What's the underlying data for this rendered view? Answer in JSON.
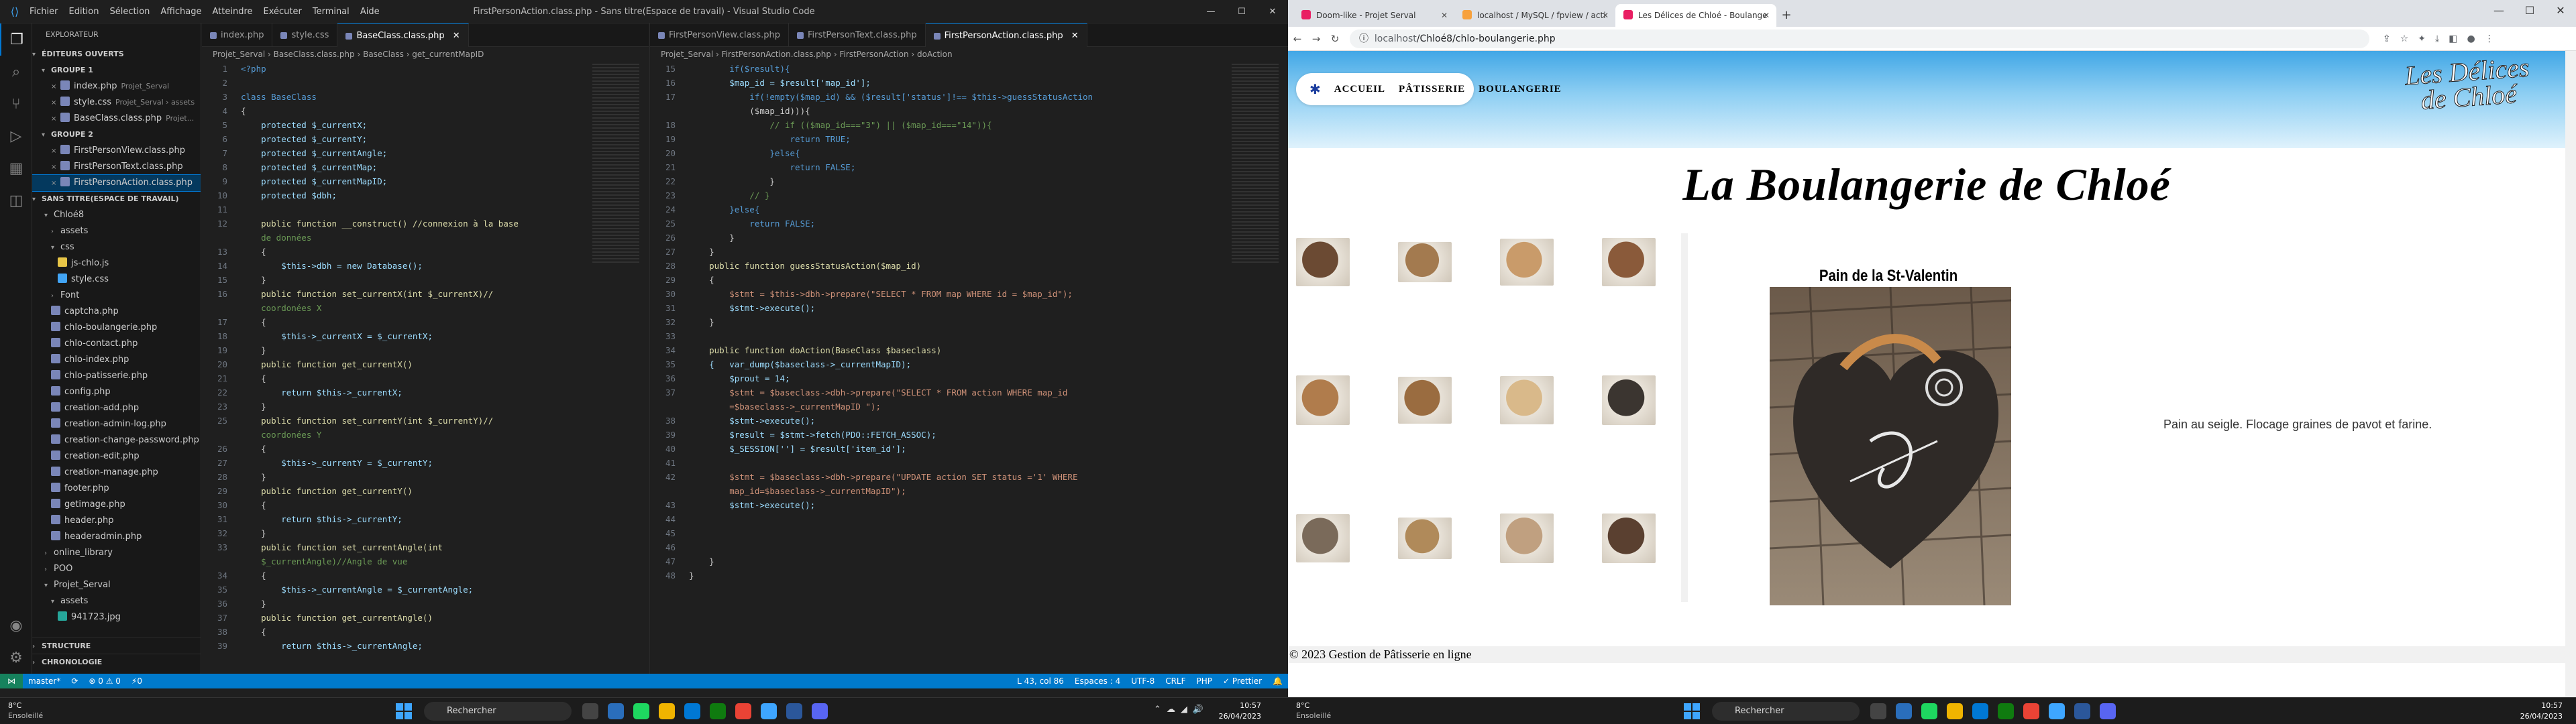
{
  "vscode": {
    "menu": [
      "Fichier",
      "Edition",
      "Sélection",
      "Affichage",
      "Atteindre",
      "Exécuter",
      "Terminal",
      "Aide"
    ],
    "window_title": "FirstPersonAction.class.php - Sans titre(Espace de travail) - Visual Studio Code",
    "sidebar": {
      "header": "EXPLORATEUR",
      "open_editors": "ÉDITEURS OUVERTS",
      "group1": "GROUPE 1",
      "group1_files": [
        {
          "name": "index.php",
          "hint": "Projet_Serval"
        },
        {
          "name": "style.css",
          "hint": "Projet_Serval › assets"
        },
        {
          "name": "BaseClass.class.php",
          "hint": "Projet..."
        }
      ],
      "group2": "GROUPE 2",
      "group2_files": [
        {
          "name": "FirstPersonView.class.php"
        },
        {
          "name": "FirstPersonText.class.php"
        },
        {
          "name": "FirstPersonAction.class.php"
        }
      ],
      "workspace": "SANS TITRE(ESPACE DE TRAVAIL)",
      "tree": [
        {
          "name": "Chloé8",
          "type": "folder",
          "open": true
        },
        {
          "name": "assets",
          "type": "folder"
        },
        {
          "name": "css",
          "type": "folder",
          "open": true
        },
        {
          "name": "js-chlo.js",
          "type": "js"
        },
        {
          "name": "style.css",
          "type": "css"
        },
        {
          "name": "Font",
          "type": "folder"
        },
        {
          "name": "captcha.php",
          "type": "php"
        },
        {
          "name": "chlo-boulangerie.php",
          "type": "php"
        },
        {
          "name": "chlo-contact.php",
          "type": "php"
        },
        {
          "name": "chlo-index.php",
          "type": "php"
        },
        {
          "name": "chlo-patisserie.php",
          "type": "php"
        },
        {
          "name": "config.php",
          "type": "php"
        },
        {
          "name": "creation-add.php",
          "type": "php"
        },
        {
          "name": "creation-admin-log.php",
          "type": "php"
        },
        {
          "name": "creation-change-password.php",
          "type": "php"
        },
        {
          "name": "creation-edit.php",
          "type": "php"
        },
        {
          "name": "creation-manage.php",
          "type": "php"
        },
        {
          "name": "footer.php",
          "type": "php"
        },
        {
          "name": "getimage.php",
          "type": "php"
        },
        {
          "name": "header.php",
          "type": "php"
        },
        {
          "name": "headeradmin.php",
          "type": "php"
        },
        {
          "name": "online_library",
          "type": "folder"
        },
        {
          "name": "POO",
          "type": "folder"
        },
        {
          "name": "Projet_Serval",
          "type": "folder",
          "open": true
        },
        {
          "name": "assets",
          "type": "folder",
          "open": true
        },
        {
          "name": "941723.jpg",
          "type": "jpg"
        }
      ],
      "outline": "STRUCTURE",
      "timeline": "CHRONOLOGIE"
    },
    "pane1": {
      "tabs": [
        "index.php",
        "style.css",
        "BaseClass.class.php"
      ],
      "breadcrumb": "Projet_Serval › BaseClass.class.php › BaseClass › get_currentMapID",
      "lines": [
        {
          "n": "1",
          "t": "<?php",
          "c": "kw"
        },
        {
          "n": "2",
          "t": "",
          "c": ""
        },
        {
          "n": "3",
          "t": "class BaseClass",
          "c": "kw"
        },
        {
          "n": "4",
          "t": "{",
          "c": ""
        },
        {
          "n": "5",
          "t": "    protected $_currentX;",
          "c": "var"
        },
        {
          "n": "6",
          "t": "    protected $_currentY;",
          "c": "var"
        },
        {
          "n": "7",
          "t": "    protected $_currentAngle;",
          "c": "var"
        },
        {
          "n": "8",
          "t": "    protected $_currentMap;",
          "c": "var"
        },
        {
          "n": "9",
          "t": "    protected $_currentMapID;",
          "c": "var"
        },
        {
          "n": "10",
          "t": "    protected $dbh;",
          "c": "var"
        },
        {
          "n": "11",
          "t": "",
          "c": ""
        },
        {
          "n": "12",
          "t": "    public function __construct() //connexion à la base",
          "c": "fn"
        },
        {
          "n": "",
          "t": "    de données",
          "c": "cm"
        },
        {
          "n": "13",
          "t": "    {",
          "c": ""
        },
        {
          "n": "14",
          "t": "        $this->dbh = new Database();",
          "c": "var"
        },
        {
          "n": "15",
          "t": "    }",
          "c": ""
        },
        {
          "n": "16",
          "t": "    public function set_currentX(int $_currentX)//",
          "c": "fn"
        },
        {
          "n": "",
          "t": "    coordonées X",
          "c": "cm"
        },
        {
          "n": "17",
          "t": "    {",
          "c": ""
        },
        {
          "n": "18",
          "t": "        $this->_currentX = $_currentX;",
          "c": "var"
        },
        {
          "n": "19",
          "t": "    }",
          "c": ""
        },
        {
          "n": "20",
          "t": "    public function get_currentX()",
          "c": "fn"
        },
        {
          "n": "21",
          "t": "    {",
          "c": ""
        },
        {
          "n": "22",
          "t": "        return $this->_currentX;",
          "c": "var"
        },
        {
          "n": "23",
          "t": "    }",
          "c": ""
        },
        {
          "n": "25",
          "t": "    public function set_currentY(int $_currentY)//",
          "c": "fn"
        },
        {
          "n": "",
          "t": "    coordonées Y",
          "c": "cm"
        },
        {
          "n": "26",
          "t": "    {",
          "c": ""
        },
        {
          "n": "27",
          "t": "        $this->_currentY = $_currentY;",
          "c": "var"
        },
        {
          "n": "28",
          "t": "    }",
          "c": ""
        },
        {
          "n": "29",
          "t": "    public function get_currentY()",
          "c": "fn"
        },
        {
          "n": "30",
          "t": "    {",
          "c": ""
        },
        {
          "n": "31",
          "t": "        return $this->_currentY;",
          "c": "var"
        },
        {
          "n": "32",
          "t": "    }",
          "c": ""
        },
        {
          "n": "33",
          "t": "    public function set_currentAngle(int",
          "c": "fn"
        },
        {
          "n": "",
          "t": "    $_currentAngle)//Angle de vue",
          "c": "cm"
        },
        {
          "n": "34",
          "t": "    {",
          "c": ""
        },
        {
          "n": "35",
          "t": "        $this->_currentAngle = $_currentAngle;",
          "c": "var"
        },
        {
          "n": "36",
          "t": "    }",
          "c": ""
        },
        {
          "n": "37",
          "t": "    public function get_currentAngle()",
          "c": "fn"
        },
        {
          "n": "38",
          "t": "    {",
          "c": ""
        },
        {
          "n": "39",
          "t": "        return $this->_currentAngle;",
          "c": "var"
        }
      ]
    },
    "pane2": {
      "tabs": [
        "FirstPersonView.class.php",
        "FirstPersonText.class.php",
        "FirstPersonAction.class.php"
      ],
      "breadcrumb": "Projet_Serval › FirstPersonAction.class.php › FirstPersonAction › doAction",
      "lines": [
        {
          "n": "15",
          "t": "        if($result){",
          "c": "kw"
        },
        {
          "n": "16",
          "t": "        $map_id = $result['map_id'];",
          "c": "var"
        },
        {
          "n": "17",
          "t": "            if(!empty($map_id) && ($result['status']!== $this->guessStatusAction",
          "c": "kw"
        },
        {
          "n": "",
          "t": "            ($map_id))){",
          "c": ""
        },
        {
          "n": "18",
          "t": "                // if (($map_id===\"3\") || ($map_id===\"14\")){",
          "c": "cm"
        },
        {
          "n": "19",
          "t": "                    return TRUE;",
          "c": "kw"
        },
        {
          "n": "20",
          "t": "                }else{",
          "c": "kw"
        },
        {
          "n": "21",
          "t": "                    return FALSE;",
          "c": "kw"
        },
        {
          "n": "22",
          "t": "                }",
          "c": ""
        },
        {
          "n": "23",
          "t": "            // }",
          "c": "cm"
        },
        {
          "n": "24",
          "t": "        }else{",
          "c": "kw"
        },
        {
          "n": "25",
          "t": "            return FALSE;",
          "c": "kw"
        },
        {
          "n": "26",
          "t": "        }",
          "c": ""
        },
        {
          "n": "27",
          "t": "    }",
          "c": ""
        },
        {
          "n": "28",
          "t": "    public function guessStatusAction($map_id)",
          "c": "fn"
        },
        {
          "n": "29",
          "t": "    {",
          "c": ""
        },
        {
          "n": "30",
          "t": "        $stmt = $this->dbh->prepare(\"SELECT * FROM map WHERE id = $map_id\");",
          "c": "str"
        },
        {
          "n": "31",
          "t": "        $stmt->execute();",
          "c": "var"
        },
        {
          "n": "32",
          "t": "    }",
          "c": ""
        },
        {
          "n": "33",
          "t": "",
          "c": ""
        },
        {
          "n": "34",
          "t": "    public function doAction(BaseClass $baseclass)",
          "c": "fn"
        },
        {
          "n": "35",
          "t": "    {   var_dump($baseclass->_currentMapID);",
          "c": "var"
        },
        {
          "n": "36",
          "t": "        $prout = 14;",
          "c": "var"
        },
        {
          "n": "37",
          "t": "        $stmt = $baseclass->dbh->prepare(\"SELECT * FROM action WHERE map_id",
          "c": "str"
        },
        {
          "n": "",
          "t": "        =$baseclass->_currentMapID \");",
          "c": "str"
        },
        {
          "n": "38",
          "t": "        $stmt->execute();",
          "c": "var"
        },
        {
          "n": "39",
          "t": "        $result = $stmt->fetch(PDO::FETCH_ASSOC);",
          "c": "var"
        },
        {
          "n": "40",
          "t": "        $_SESSION[''] = $result['item_id'];",
          "c": "var"
        },
        {
          "n": "41",
          "t": "",
          "c": ""
        },
        {
          "n": "42",
          "t": "        $stmt = $baseclass->dbh->prepare(\"UPDATE action SET status ='1' WHERE",
          "c": "str"
        },
        {
          "n": "",
          "t": "        map_id=$baseclass->_currentMapID\");",
          "c": "str"
        },
        {
          "n": "43",
          "t": "        $stmt->execute();",
          "c": "var"
        },
        {
          "n": "44",
          "t": "",
          "c": ""
        },
        {
          "n": "45",
          "t": "",
          "c": ""
        },
        {
          "n": "46",
          "t": "",
          "c": ""
        },
        {
          "n": "47",
          "t": "    }",
          "c": ""
        },
        {
          "n": "48",
          "t": "}",
          "c": ""
        }
      ]
    },
    "status": {
      "branch": "master*",
      "sync": "⟳",
      "problems": "⊗ 0 ⚠ 0",
      "ports": "⚡0",
      "position": "L 43, col 86",
      "spaces": "Espaces : 4",
      "encoding": "UTF-8",
      "eol": "CRLF",
      "lang": "PHP",
      "prettier": "✓ Prettier"
    }
  },
  "browser": {
    "tabs": [
      {
        "title": "Doom-like - Projet Serval",
        "color": "#e91e63"
      },
      {
        "title": "localhost / MySQL / fpview / acti",
        "color": "#f7a13d"
      },
      {
        "title": "Les Délices de Chloé - Boulange",
        "color": "#e91e63"
      }
    ],
    "url_host": "localhost",
    "url_path": "/Chloé8/chlo-boulangerie.php",
    "nav": [
      "ACCUEIL",
      "PÂTISSERIE",
      "BOULANGERIE"
    ],
    "logo": "Les Délices de Chloé",
    "page_title": "La Boulangerie de Chloé",
    "product_title": "Pain de la St-Valentin",
    "product_desc": "Pain au seigle. Flocage graines de pavot et farine.",
    "footer": "© 2023 Gestion de Pâtisserie en ligne",
    "thumb_colors": [
      "#6b4a33",
      "#a37a4f",
      "#c99b6a",
      "#8a5a3a",
      "#b07c4c",
      "#9a6c40",
      "#d9b98a",
      "#3b3530",
      "#7a6a5a",
      "#b08a5a",
      "#c0a080",
      "#5a4030"
    ]
  },
  "taskbar": {
    "weather_temp": "8°C",
    "weather_desc": "Ensoleillé",
    "search": "Rechercher",
    "time_left": "10:57",
    "date_left": "26/04/2023",
    "time_right": "10:57",
    "date_right": "26/04/2023",
    "app_colors": [
      "#444",
      "#2a6ebb",
      "#1ed760",
      "#f0b400",
      "#0078d4",
      "#0f7b0f",
      "#ea4335",
      "#3ea6ff",
      "#2b579a",
      "#5865f2"
    ]
  }
}
